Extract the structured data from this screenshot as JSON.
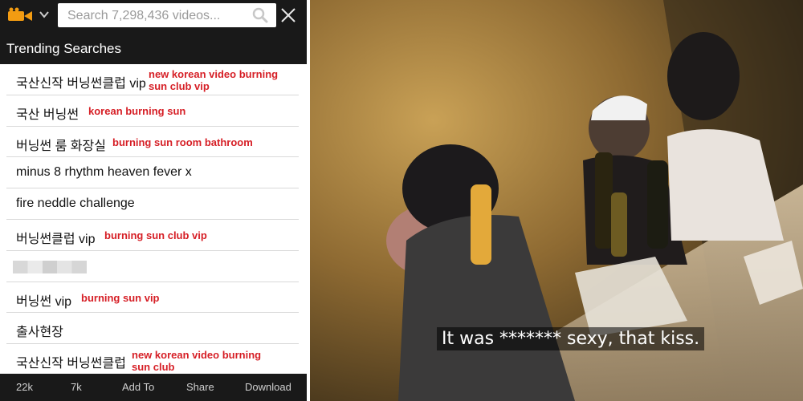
{
  "search": {
    "placeholder": "Search 7,298,436 videos..."
  },
  "trending": {
    "title": "Trending Searches",
    "items": [
      {
        "term": "국산신작 버닝썬클럽 vip",
        "translation": "new korean video burning\nsun club vip"
      },
      {
        "term": "국산 버닝썬",
        "translation": "korean burning sun"
      },
      {
        "term": "버닝썬 룸 화장실",
        "translation": "burning sun room bathroom"
      },
      {
        "term": "minus 8 rhythm heaven fever x",
        "translation": ""
      },
      {
        "term": "fire neddle challenge",
        "translation": ""
      },
      {
        "term": "버닝썬클럽 vip",
        "translation": "burning sun club vip"
      },
      {
        "term": "",
        "translation": ""
      },
      {
        "term": "버닝썬 vip",
        "translation": "burning sun vip"
      },
      {
        "term": "출사현장",
        "translation": ""
      },
      {
        "term": "국산신작 버닝썬클럽",
        "translation": "new korean video burning\nsun club"
      }
    ]
  },
  "bottom_bar": {
    "views": "22k",
    "likes": "7k",
    "add_to": "Add To",
    "share": "Share",
    "download": "Download"
  },
  "photo": {
    "caption": "It was ******* sexy, that kiss."
  },
  "colors": {
    "bar_bg": "#191919",
    "accent_orange": "#f39c12",
    "translation_red": "#d61f26"
  }
}
